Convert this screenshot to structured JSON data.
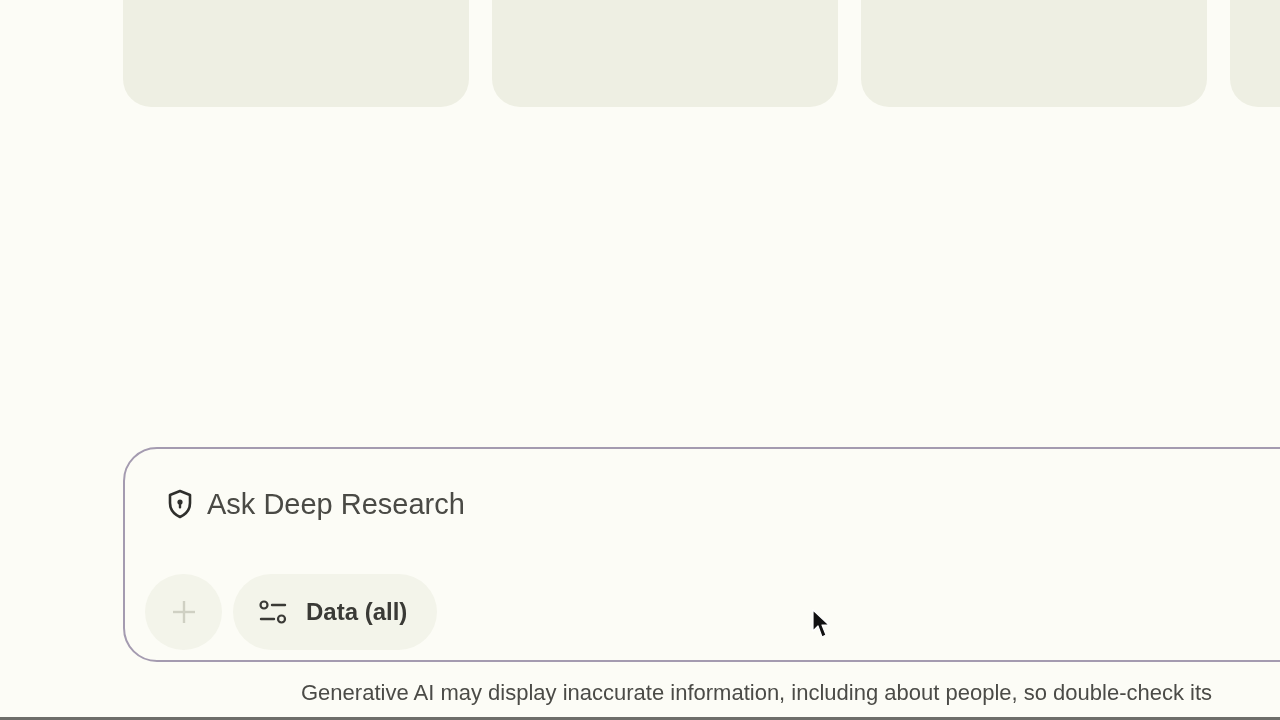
{
  "prompt": {
    "placeholder": "Ask Deep Research",
    "add_button": {
      "disabled": true
    },
    "data_chip": {
      "label": "Data (all)"
    }
  },
  "disclaimer": "Generative AI may display inaccurate information, including about people, so double-check its"
}
